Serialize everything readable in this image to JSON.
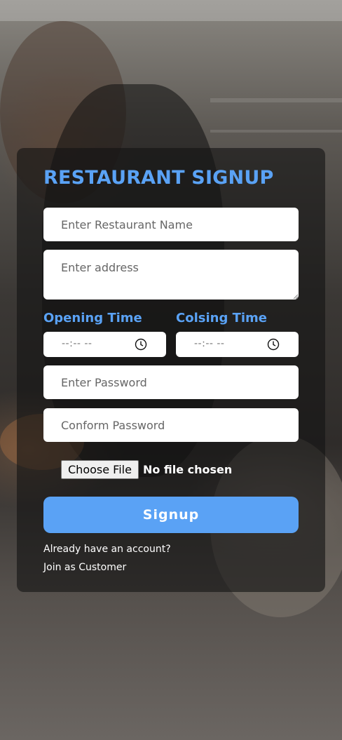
{
  "form": {
    "title": "RESTAURANT SIGNUP",
    "restaurant_name_placeholder": "Enter Restaurant Name",
    "address_placeholder": "Enter address",
    "opening_time_label": "Opening Time",
    "closing_time_label": "Colsing Time",
    "opening_time_value": "--:-- --",
    "closing_time_value": "--:-- --",
    "password_placeholder": "Enter Password",
    "confirm_password_placeholder": "Conform Password",
    "file_button_label": "Choose File",
    "file_status": "No file chosen",
    "signup_label": "Signup",
    "login_prompt": "Already have an account?",
    "customer_link": "Join as Customer"
  },
  "icons": {
    "time_icon": "clock-icon",
    "resize": "resize-grip-icon"
  },
  "colors": {
    "accent": "#5aa2f5",
    "card": "#141414",
    "field": "#ffffff"
  }
}
